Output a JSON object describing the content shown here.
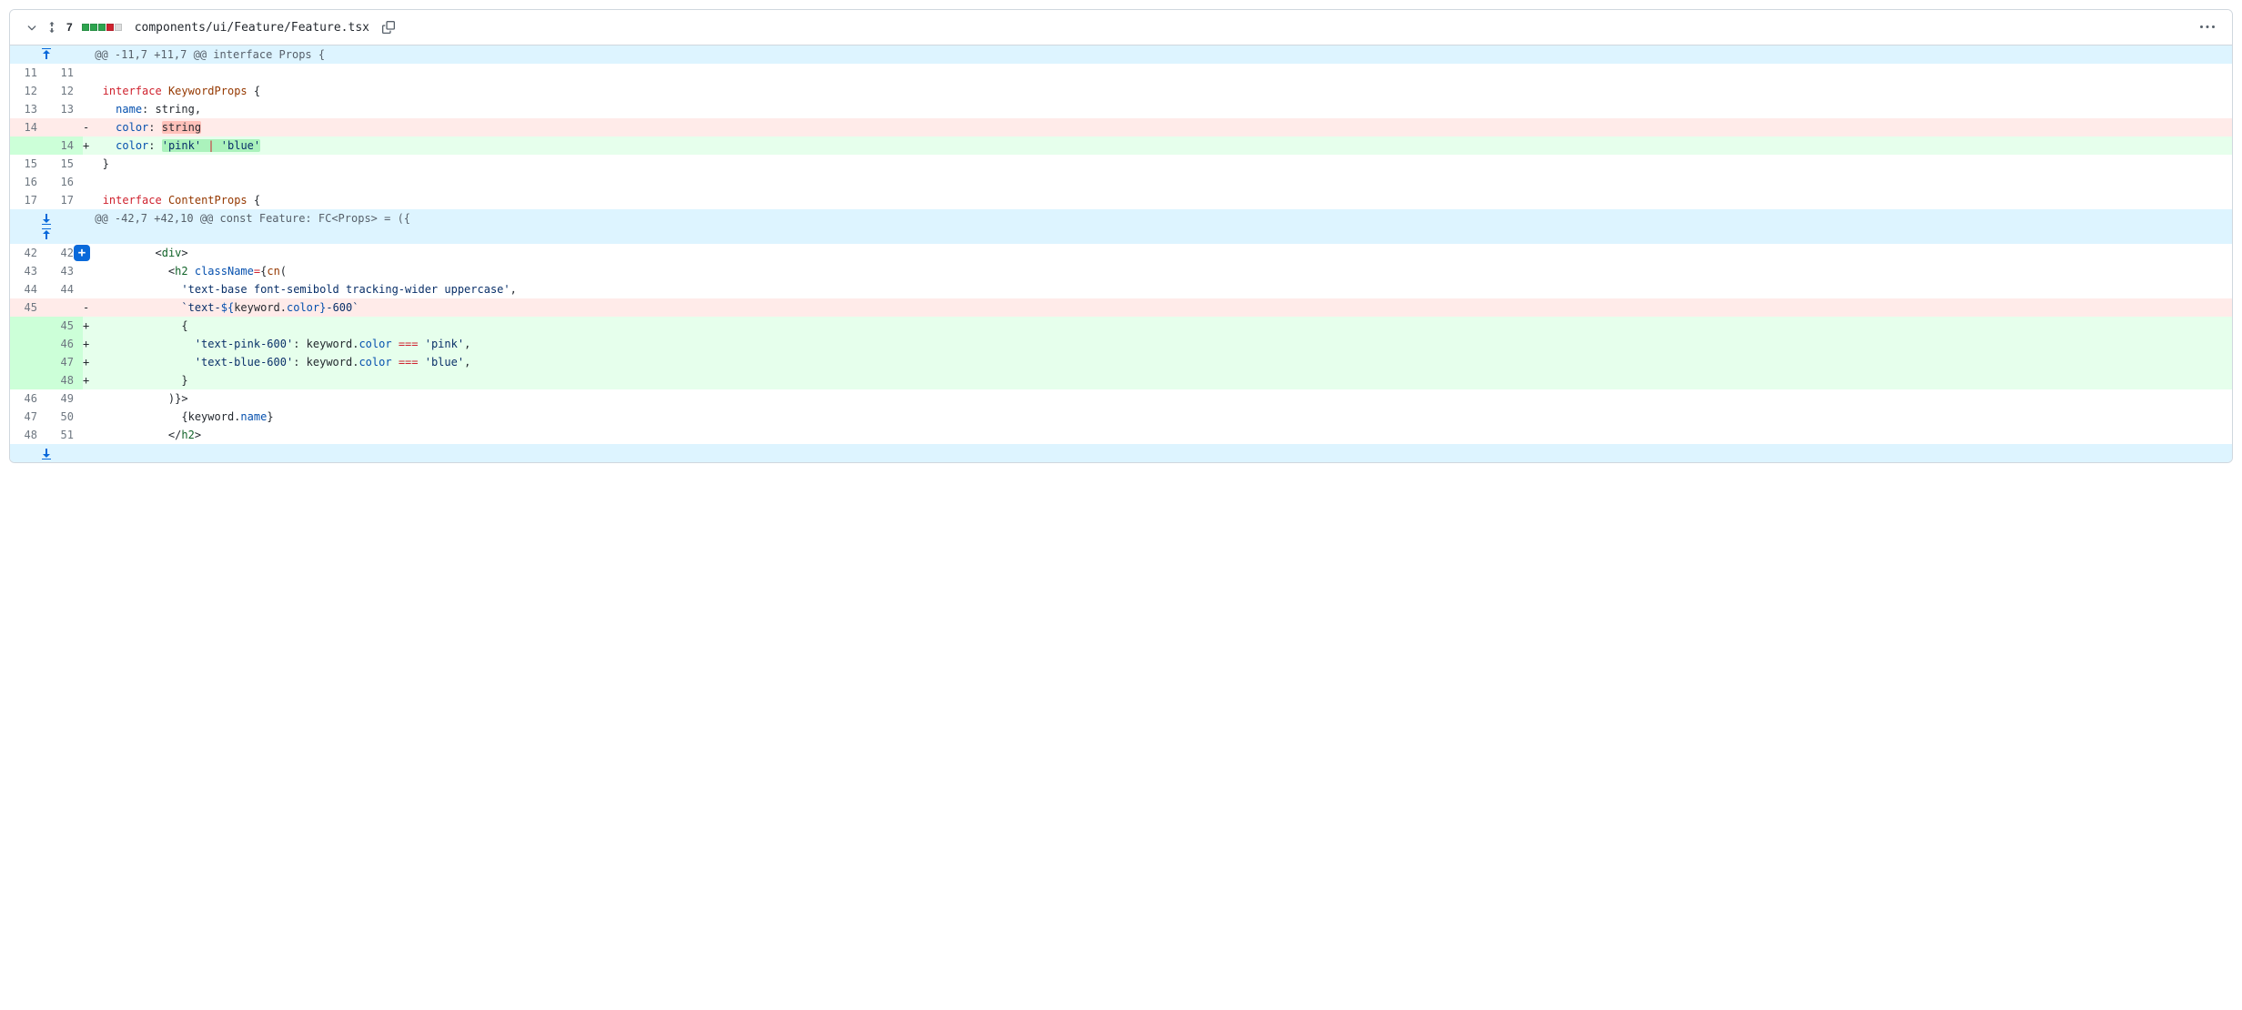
{
  "file": {
    "change_count": "7",
    "stat_blocks": [
      "green",
      "green",
      "green",
      "red",
      "gray"
    ],
    "path": "components/ui/Feature/Feature.tsx"
  },
  "hunks": [
    {
      "header": "@@ -11,7 +11,7 @@ interface Props {",
      "expand_top": true,
      "expand_bottom_split": true,
      "lines": [
        {
          "old": "11",
          "new": "11",
          "type": "ctx",
          "marker": " ",
          "tokens": []
        },
        {
          "old": "12",
          "new": "12",
          "type": "ctx",
          "marker": " ",
          "tokens": [
            {
              "t": "plain",
              "v": "  "
            },
            {
              "t": "kw",
              "v": "interface"
            },
            {
              "t": "plain",
              "v": " "
            },
            {
              "t": "ident",
              "v": "KeywordProps"
            },
            {
              "t": "plain",
              "v": " {"
            }
          ]
        },
        {
          "old": "13",
          "new": "13",
          "type": "ctx",
          "marker": " ",
          "tokens": [
            {
              "t": "plain",
              "v": "    "
            },
            {
              "t": "attr",
              "v": "name"
            },
            {
              "t": "plain",
              "v": ": string,"
            }
          ]
        },
        {
          "old": "14",
          "new": "",
          "type": "del",
          "marker": "-",
          "tokens": [
            {
              "t": "plain",
              "v": "    "
            },
            {
              "t": "attr",
              "v": "color"
            },
            {
              "t": "plain",
              "v": ": "
            },
            {
              "t": "hl-del",
              "v": "string"
            }
          ]
        },
        {
          "old": "",
          "new": "14",
          "type": "add",
          "marker": "+",
          "tokens": [
            {
              "t": "plain",
              "v": "    "
            },
            {
              "t": "attr",
              "v": "color"
            },
            {
              "t": "plain",
              "v": ": "
            },
            {
              "t": "hl-add",
              "inner": [
                {
                  "t": "str",
                  "v": "'pink'"
                },
                {
                  "t": "plain",
                  "v": " "
                },
                {
                  "t": "kw",
                  "v": "|"
                },
                {
                  "t": "plain",
                  "v": " "
                },
                {
                  "t": "str",
                  "v": "'blue'"
                }
              ]
            }
          ]
        },
        {
          "old": "15",
          "new": "15",
          "type": "ctx",
          "marker": " ",
          "tokens": [
            {
              "t": "plain",
              "v": "  }"
            }
          ]
        },
        {
          "old": "16",
          "new": "16",
          "type": "ctx",
          "marker": " ",
          "tokens": []
        },
        {
          "old": "17",
          "new": "17",
          "type": "ctx",
          "marker": " ",
          "tokens": [
            {
              "t": "plain",
              "v": "  "
            },
            {
              "t": "kw",
              "v": "interface"
            },
            {
              "t": "plain",
              "v": " "
            },
            {
              "t": "ident",
              "v": "ContentProps"
            },
            {
              "t": "plain",
              "v": " {"
            }
          ]
        }
      ]
    },
    {
      "header": "@@ -42,7 +42,10 @@ const Feature: FC<Props> = ({",
      "expand_bottom": true,
      "lines": [
        {
          "old": "42",
          "new": "42",
          "type": "ctx",
          "marker": " ",
          "showAddBtn": true,
          "tokens": [
            {
              "t": "plain",
              "v": "          "
            },
            {
              "t": "plain",
              "v": "<"
            },
            {
              "t": "tag",
              "v": "div"
            },
            {
              "t": "plain",
              "v": ">"
            }
          ]
        },
        {
          "old": "43",
          "new": "43",
          "type": "ctx",
          "marker": " ",
          "tokens": [
            {
              "t": "plain",
              "v": "            "
            },
            {
              "t": "plain",
              "v": "<"
            },
            {
              "t": "tag",
              "v": "h2"
            },
            {
              "t": "plain",
              "v": " "
            },
            {
              "t": "attr",
              "v": "className"
            },
            {
              "t": "kw",
              "v": "="
            },
            {
              "t": "plain",
              "v": "{"
            },
            {
              "t": "ident",
              "v": "cn"
            },
            {
              "t": "plain",
              "v": "("
            }
          ]
        },
        {
          "old": "44",
          "new": "44",
          "type": "ctx",
          "marker": " ",
          "tokens": [
            {
              "t": "plain",
              "v": "              "
            },
            {
              "t": "str",
              "v": "'text-base font-semibold tracking-wider uppercase'"
            },
            {
              "t": "plain",
              "v": ","
            }
          ]
        },
        {
          "old": "45",
          "new": "",
          "type": "del",
          "marker": "-",
          "tokens": [
            {
              "t": "plain",
              "v": "              "
            },
            {
              "t": "str",
              "v": "`text-"
            },
            {
              "t": "attr",
              "v": "${"
            },
            {
              "t": "plain",
              "v": "keyword"
            },
            {
              "t": "plain",
              "v": "."
            },
            {
              "t": "attr",
              "v": "color"
            },
            {
              "t": "attr",
              "v": "}"
            },
            {
              "t": "str",
              "v": "-600`"
            }
          ]
        },
        {
          "old": "",
          "new": "45",
          "type": "add",
          "marker": "+",
          "tokens": [
            {
              "t": "plain",
              "v": "              {"
            }
          ]
        },
        {
          "old": "",
          "new": "46",
          "type": "add",
          "marker": "+",
          "tokens": [
            {
              "t": "plain",
              "v": "                "
            },
            {
              "t": "str",
              "v": "'text-pink-600'"
            },
            {
              "t": "plain",
              "v": ": keyword."
            },
            {
              "t": "attr",
              "v": "color"
            },
            {
              "t": "plain",
              "v": " "
            },
            {
              "t": "kw",
              "v": "==="
            },
            {
              "t": "plain",
              "v": " "
            },
            {
              "t": "str",
              "v": "'pink'"
            },
            {
              "t": "plain",
              "v": ","
            }
          ]
        },
        {
          "old": "",
          "new": "47",
          "type": "add",
          "marker": "+",
          "tokens": [
            {
              "t": "plain",
              "v": "                "
            },
            {
              "t": "str",
              "v": "'text-blue-600'"
            },
            {
              "t": "plain",
              "v": ": keyword."
            },
            {
              "t": "attr",
              "v": "color"
            },
            {
              "t": "plain",
              "v": " "
            },
            {
              "t": "kw",
              "v": "==="
            },
            {
              "t": "plain",
              "v": " "
            },
            {
              "t": "str",
              "v": "'blue'"
            },
            {
              "t": "plain",
              "v": ","
            }
          ]
        },
        {
          "old": "",
          "new": "48",
          "type": "add",
          "marker": "+",
          "tokens": [
            {
              "t": "plain",
              "v": "              }"
            }
          ]
        },
        {
          "old": "46",
          "new": "49",
          "type": "ctx",
          "marker": " ",
          "tokens": [
            {
              "t": "plain",
              "v": "            )}>"
            }
          ]
        },
        {
          "old": "47",
          "new": "50",
          "type": "ctx",
          "marker": " ",
          "tokens": [
            {
              "t": "plain",
              "v": "              {keyword."
            },
            {
              "t": "attr",
              "v": "name"
            },
            {
              "t": "plain",
              "v": "}"
            }
          ]
        },
        {
          "old": "48",
          "new": "51",
          "type": "ctx",
          "marker": " ",
          "tokens": [
            {
              "t": "plain",
              "v": "            "
            },
            {
              "t": "plain",
              "v": "</"
            },
            {
              "t": "tag",
              "v": "h2"
            },
            {
              "t": "plain",
              "v": ">"
            }
          ]
        }
      ]
    }
  ]
}
